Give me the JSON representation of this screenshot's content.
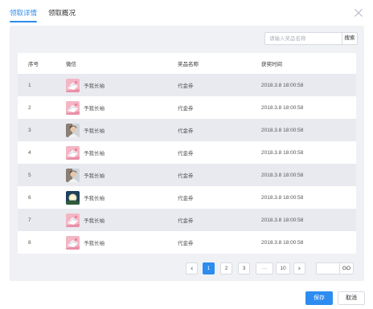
{
  "tabs": [
    {
      "label": "领取详情",
      "active": true
    },
    {
      "label": "领取概况",
      "active": false
    }
  ],
  "search": {
    "placeholder": "请输入奖品名称",
    "button_label": "搜索"
  },
  "table": {
    "headers": [
      "序号",
      "微信",
      "奖品名称",
      "获奖时间"
    ],
    "rows": [
      {
        "index": "1",
        "wechat": "予我长袖",
        "avatar": "cat-icon",
        "prize": "代金券",
        "time": "2018.3.8 18:00:58"
      },
      {
        "index": "2",
        "wechat": "予我长袖",
        "avatar": "cat-icon",
        "prize": "代金券",
        "time": "2018.3.8 18:00:58"
      },
      {
        "index": "3",
        "wechat": "予我长袖",
        "avatar": "portrait-icon",
        "prize": "代金券",
        "time": "2018.3.8 18:00:58"
      },
      {
        "index": "4",
        "wechat": "予我长袖",
        "avatar": "cat-icon",
        "prize": "代金券",
        "time": "2018.3.8 18:00:58"
      },
      {
        "index": "5",
        "wechat": "予我长袖",
        "avatar": "portrait-icon",
        "prize": "代金券",
        "time": "2018.3.8 18:00:58"
      },
      {
        "index": "6",
        "wechat": "予我长袖",
        "avatar": "landscape-icon",
        "prize": "代金券",
        "time": "2018.3.8 18:00:58"
      },
      {
        "index": "7",
        "wechat": "予我长袖",
        "avatar": "cat-icon",
        "prize": "代金券",
        "time": "2018.3.8 18:00:58"
      },
      {
        "index": "8",
        "wechat": "予我长袖",
        "avatar": "cat-icon",
        "prize": "代金券",
        "time": "2018.3.8 18:00:58"
      }
    ]
  },
  "pagination": {
    "prev_icon": "chevron-left-icon",
    "next_icon": "chevron-right-icon",
    "pages": [
      "1",
      "2",
      "3"
    ],
    "ellipsis": "···",
    "last_page": "10",
    "current": "1",
    "go_label": "GO"
  },
  "footer": {
    "save_label": "保存",
    "cancel_label": "取消"
  },
  "colors": {
    "accent": "#2d8cf0",
    "panel_bg": "#f0f1f5",
    "row_stripe": "#e9eaf0"
  }
}
